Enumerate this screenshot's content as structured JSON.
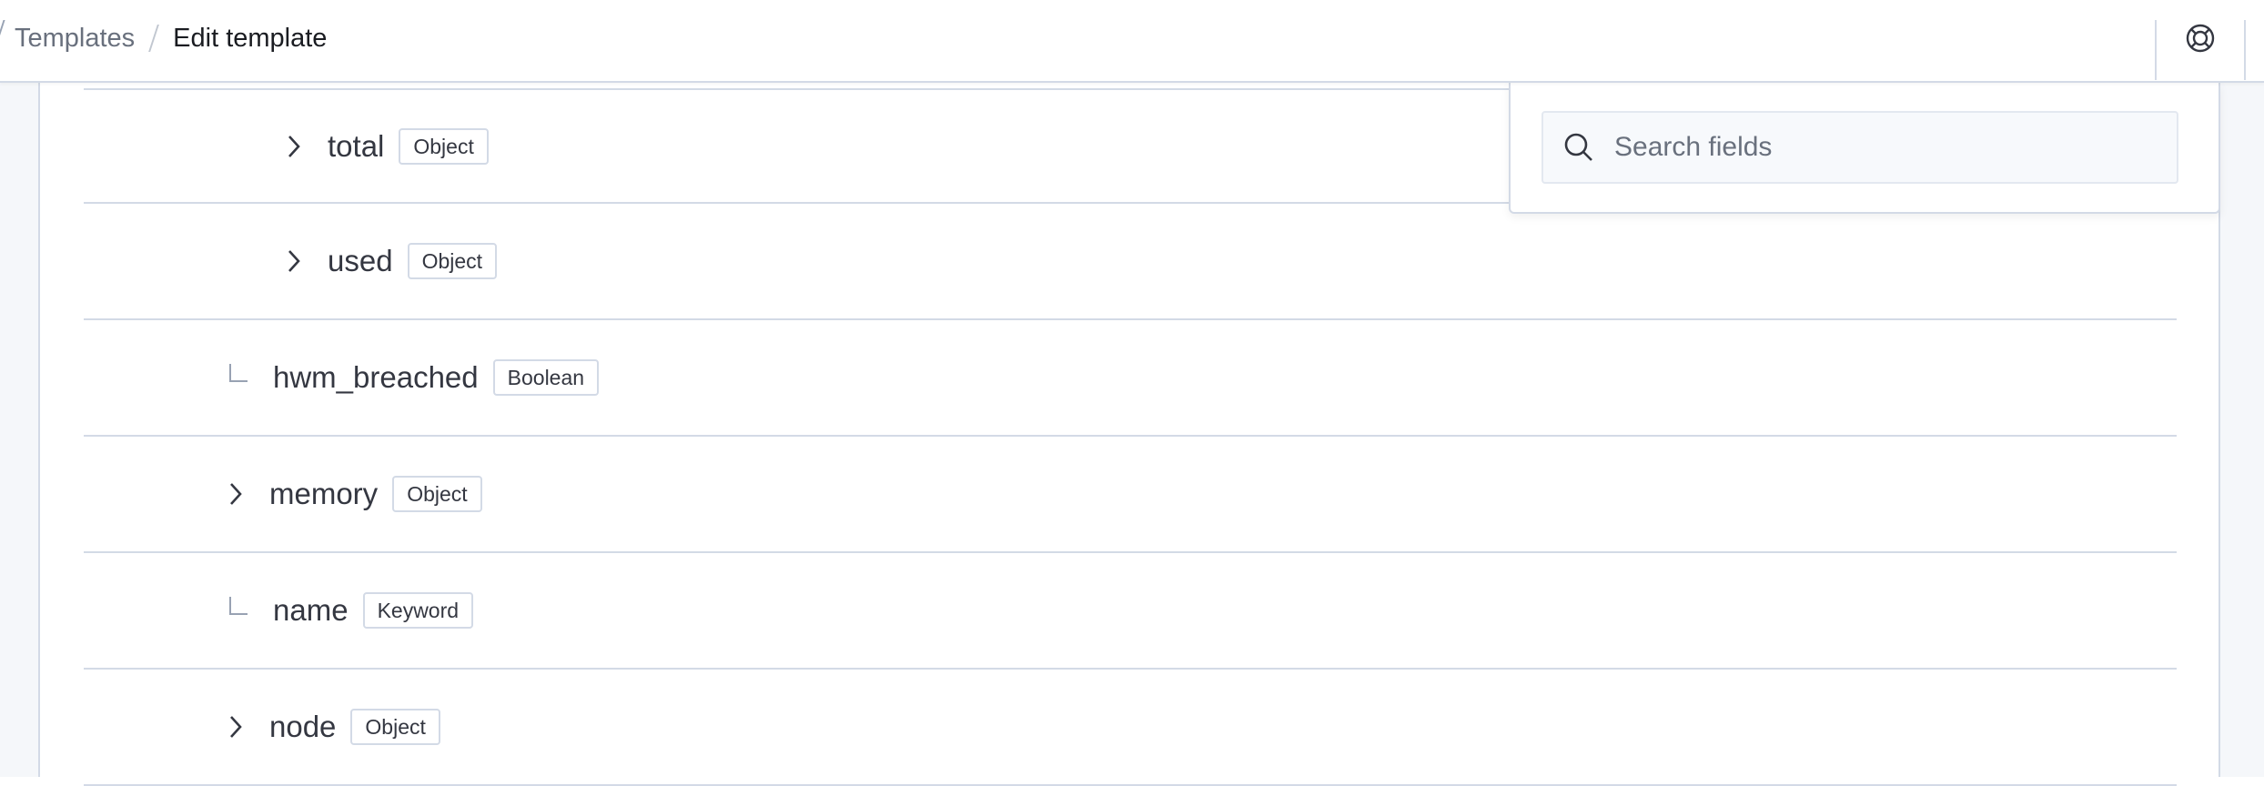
{
  "breadcrumb": {
    "parent": "Templates",
    "current": "Edit template"
  },
  "header": {
    "help_icon": "help-lifebuoy-icon"
  },
  "search": {
    "placeholder": "Search fields",
    "icon": "search-icon"
  },
  "fields": [
    {
      "name": "total",
      "type": "Object",
      "expandable": true
    },
    {
      "name": "used",
      "type": "Object",
      "expandable": true
    },
    {
      "name": "hwm_breached",
      "type": "Boolean",
      "expandable": false
    },
    {
      "name": "memory",
      "type": "Object",
      "expandable": true
    },
    {
      "name": "name",
      "type": "Keyword",
      "expandable": false
    },
    {
      "name": "node",
      "type": "Object",
      "expandable": true
    }
  ],
  "colors": {
    "border": "#d3dae6",
    "text": "#343741",
    "muted": "#69707d",
    "page_bg": "#f5f7fa"
  }
}
